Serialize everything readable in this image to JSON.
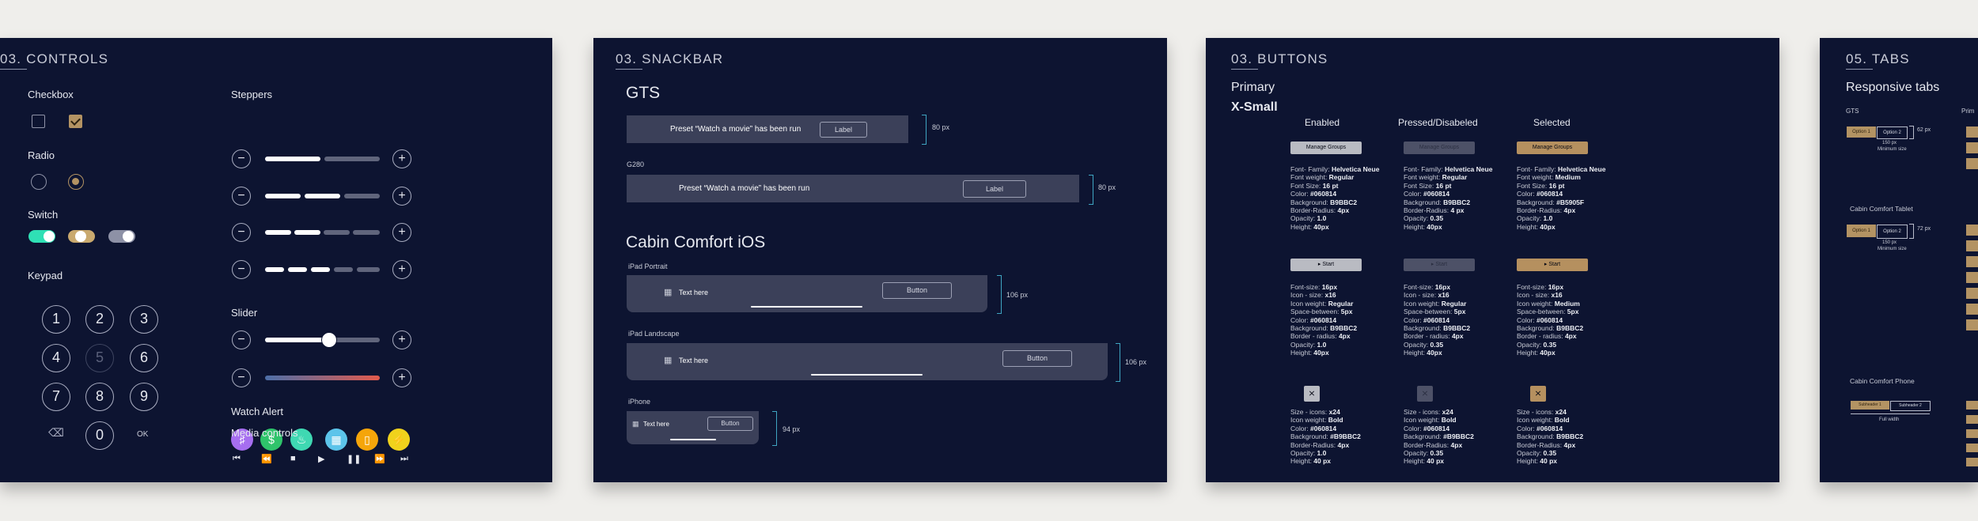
{
  "controls": {
    "title": "03. CONTROLS",
    "checkbox": "Checkbox",
    "radio": "Radio",
    "switch": "Switch",
    "keypad": "Keypad",
    "keys": [
      "1",
      "2",
      "3",
      "4",
      "5",
      "6",
      "7",
      "8",
      "9",
      "0"
    ],
    "ok": "OK",
    "steppers": "Steppers",
    "slider": "Slider",
    "slider_value": 0.56,
    "watch_alert": "Watch Alert",
    "media_controls": "Media controls",
    "colors": {
      "accent": "#b39363",
      "teal": "#2fe0b5",
      "red": "#e25a4c"
    }
  },
  "snackbar": {
    "title": "03. SNACKBAR",
    "gts": "GTS",
    "preset_msg": "Preset  “Watch a movie” has been run",
    "label": "Label",
    "h80a": "80 px",
    "g280": "G280",
    "h80b": "80 px",
    "cabin_ios": "Cabin Comfort iOS",
    "ipad_portrait": "iPad Portrait",
    "text_here": "Text here",
    "button": "Button",
    "h106a": "106 px",
    "ipad_landscape": "iPad Landscape",
    "h106b": "106 px",
    "iphone": "iPhone",
    "h94": "94 px"
  },
  "buttons": {
    "title": "03. BUTTONS",
    "primary": "Primary",
    "xsmall": "X-Small",
    "states": [
      "Enabled",
      "Pressed/Disabeled",
      "Selected"
    ],
    "manage_groups": "Manage Groups",
    "start": "▸ Start",
    "specs1": [
      [
        "Font- Family: ",
        "Helvetica Neue"
      ],
      [
        "Font weight: ",
        "Regular"
      ],
      [
        "Font Size: ",
        "16 pt"
      ],
      [
        "Color: ",
        "#060814"
      ],
      [
        "Background: ",
        "B9BBC2"
      ],
      [
        "Border-Radius: ",
        "4px"
      ],
      [
        "Opacity: ",
        "1.0"
      ],
      [
        "Height: ",
        "40px"
      ]
    ],
    "specs2": [
      [
        "Font- Family: ",
        "Helvetica Neue"
      ],
      [
        "Font weight: ",
        "Regular"
      ],
      [
        "Font Size: ",
        "16 pt"
      ],
      [
        "Color: ",
        "#060814"
      ],
      [
        "Background: ",
        "B9BBC2"
      ],
      [
        "Border-Radius: ",
        "4 px"
      ],
      [
        "Opacity: ",
        "0.35"
      ],
      [
        "Height: ",
        "40px"
      ]
    ],
    "specs3": [
      [
        "Font- Family: ",
        "Helvetica Neue"
      ],
      [
        "Font weight: ",
        "Medium"
      ],
      [
        "Font Size: ",
        "16 pt"
      ],
      [
        "Color: ",
        "#060814"
      ],
      [
        "Background: ",
        "#B5905F"
      ],
      [
        "Border-Radius: ",
        "4px"
      ],
      [
        "Opacity: ",
        "1.0"
      ],
      [
        "Height: ",
        "40px"
      ]
    ],
    "specs4": [
      [
        "Font-size: ",
        "16px"
      ],
      [
        "Icon - size: ",
        "x16"
      ],
      [
        "Icon weight: ",
        "Regular"
      ],
      [
        "Space-between: ",
        "5px"
      ],
      [
        "Color: ",
        "#060814"
      ],
      [
        "Background: ",
        "B9BBC2"
      ],
      [
        "Border - radius: ",
        "4px"
      ],
      [
        "Opacity: ",
        "1.0"
      ],
      [
        "Height: ",
        "40px"
      ]
    ],
    "specs5": [
      [
        "Font-size: ",
        "16px"
      ],
      [
        "Icon - size: ",
        "x16"
      ],
      [
        "Icon weight: ",
        "Regular"
      ],
      [
        "Space-between: ",
        "5px"
      ],
      [
        "Color: ",
        "#060814"
      ],
      [
        "Background: ",
        "B9BBC2"
      ],
      [
        "Border - radius: ",
        "4px"
      ],
      [
        "Opacity: ",
        "0.35"
      ],
      [
        "Height: ",
        "40px"
      ]
    ],
    "specs6": [
      [
        "Font-size: ",
        "16px"
      ],
      [
        "Icon - size: ",
        "x16"
      ],
      [
        "Icon weight: ",
        "Medium"
      ],
      [
        "Space-between: ",
        "5px"
      ],
      [
        "Color: ",
        "#060814"
      ],
      [
        "Background: ",
        "B9BBC2"
      ],
      [
        "Border - radius: ",
        "4px"
      ],
      [
        "Opacity: ",
        "0.35"
      ],
      [
        "Height: ",
        "40px"
      ]
    ],
    "specs7": [
      [
        "Size - icons: ",
        "x24"
      ],
      [
        "Icon weight: ",
        "Bold"
      ],
      [
        "Color: ",
        "#060814"
      ],
      [
        "Background: ",
        "#B9BBC2"
      ],
      [
        "Border-Radius: ",
        "4px"
      ],
      [
        "Opacity: ",
        "1.0"
      ],
      [
        "Height: ",
        "40 px"
      ]
    ],
    "specs8": [
      [
        "Size - icons: ",
        "x24"
      ],
      [
        "Icon weight: ",
        "Bold"
      ],
      [
        "Color: ",
        "#060814"
      ],
      [
        "Background: ",
        "#B9BBC2"
      ],
      [
        "Border-Radius: ",
        "4px"
      ],
      [
        "Opacity: ",
        "0.35"
      ],
      [
        "Height: ",
        "40 px"
      ]
    ],
    "specs9": [
      [
        "Size - icons: ",
        "x24"
      ],
      [
        "Icon weight: ",
        "Bold"
      ],
      [
        "Color: ",
        "#060814"
      ],
      [
        "Background: ",
        "B9BBC2"
      ],
      [
        "Border-Radius: ",
        "4px"
      ],
      [
        "Opacity: ",
        "0.35"
      ],
      [
        "Height: ",
        "40 px"
      ]
    ]
  },
  "tabs": {
    "title": "05. TABS",
    "responsive": "Responsive tabs",
    "gts": "GTS",
    "option1": "Option 1",
    "option2": "Option 2",
    "w150a": "150 px",
    "min_a": "Minimum size",
    "h62": "62 px",
    "prim": "Prim",
    "cabin_tablet": "Cabin Comfort Tablet",
    "w150b": "150 px",
    "min_b": "Minimum size",
    "h72": "72 px",
    "cabin_phone": "Cabin Comfort Phone",
    "subheader1": "Subheader 1",
    "subheader2": "Subheader 2",
    "full_width": "Full width"
  }
}
